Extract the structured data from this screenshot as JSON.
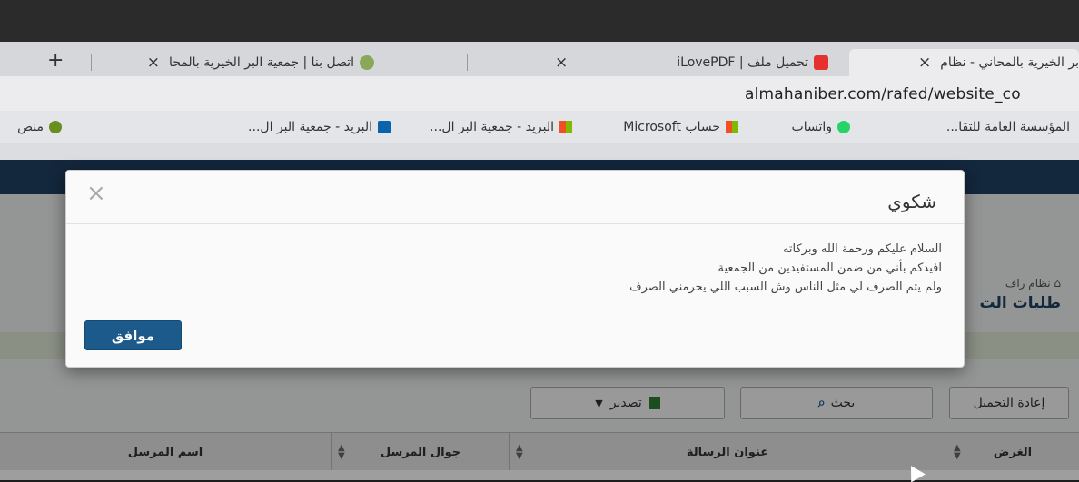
{
  "browser": {
    "tabs": [
      {
        "label": "بر الخيرية بالمحاني - نظام"
      },
      {
        "label": "تحميل ملف | iLovePDF"
      },
      {
        "label": "اتصل بنا | جمعية البر الخيرية بالمحا"
      }
    ],
    "new_tab": "+",
    "close_glyph": "×",
    "url": "almahaniber.com/rafed/website_co",
    "bookmarks": [
      {
        "label": "المؤسسة العامة للتقا..."
      },
      {
        "label": "واتساب"
      },
      {
        "label": "حساب Microsoft"
      },
      {
        "label": "البريد - جمعية البر ال..."
      },
      {
        "label": "البريد - جمعية البر ال..."
      },
      {
        "label": "منص"
      }
    ]
  },
  "page": {
    "breadcrumb": "نظام راف",
    "title": "طلبات الت",
    "toolbar": {
      "reload": "إعادة التحميل",
      "search": "بحث",
      "export": "تصدير"
    },
    "columns": [
      "الغرض",
      "عنوان الرسالة",
      "جوال المرسل",
      "اسم المرسل"
    ]
  },
  "modal": {
    "title": "شكوي",
    "body_lines": [
      "السلام عليكم ورحمة الله وبركاته",
      "افيدكم بأني من ضمن المستفيدين من الجمعية",
      "ولم يتم الصرف لي مثل الناس وش السبب اللي يحرمني الصرف"
    ],
    "close_glyph": "×",
    "ok_label": "موافق"
  }
}
